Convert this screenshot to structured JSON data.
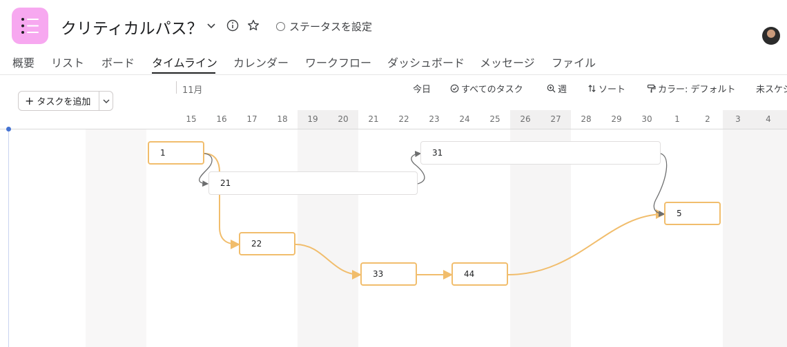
{
  "project": {
    "title": "クリティカルパス？",
    "status_label": "ステータスを設定"
  },
  "tabs": [
    {
      "label": "概要"
    },
    {
      "label": "リスト"
    },
    {
      "label": "ボード"
    },
    {
      "label": "タイムライン"
    },
    {
      "label": "カレンダー"
    },
    {
      "label": "ワークフロー"
    },
    {
      "label": "ダッシュボード"
    },
    {
      "label": "メッセージ"
    },
    {
      "label": "ファイル"
    }
  ],
  "active_tab": "タイムライン",
  "toolbar": {
    "add_task_label": "タスクを追加",
    "today_label": "今日",
    "all_tasks_label": "すべてのタスク",
    "zoom_label": "週",
    "sort_label": "ソート",
    "color_label": "カラー: デフォルト",
    "unscheduled_label": "未スケジ"
  },
  "timeline": {
    "month_label": "11月",
    "days": [
      "15",
      "16",
      "17",
      "18",
      "19",
      "20",
      "21",
      "22",
      "23",
      "24",
      "25",
      "26",
      "27",
      "28",
      "29",
      "30",
      "1",
      "2",
      "3",
      "4"
    ],
    "weekend_days": [
      "19",
      "20",
      "26",
      "27",
      "3",
      "4"
    ]
  },
  "tasks": [
    {
      "name": "1",
      "critical": true
    },
    {
      "name": "21",
      "critical": false
    },
    {
      "name": "31",
      "critical": false
    },
    {
      "name": "22",
      "critical": true
    },
    {
      "name": "33",
      "critical": true
    },
    {
      "name": "44",
      "critical": true
    },
    {
      "name": "5",
      "critical": true
    }
  ],
  "colors": {
    "critical": "#f1bd6c",
    "link": "#6d6e6f",
    "app_icon": "#f7a8f0",
    "today_marker": "#4573d2"
  }
}
